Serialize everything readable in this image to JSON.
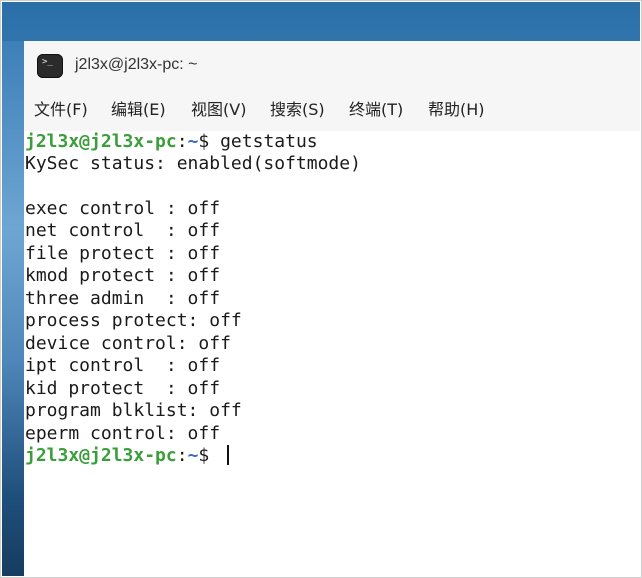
{
  "window": {
    "title": "j2l3x@j2l3x-pc: ~",
    "app_icon": "terminal-icon"
  },
  "menu": {
    "items": [
      {
        "label": "文件(F)"
      },
      {
        "label": "编辑(E)"
      },
      {
        "label": "视图(V)"
      },
      {
        "label": "搜索(S)"
      },
      {
        "label": "终端(T)"
      },
      {
        "label": "帮助(H)"
      }
    ]
  },
  "terminal": {
    "prompt_user": "j2l3x@j2l3x-pc",
    "prompt_sep": ":",
    "prompt_path": "~",
    "prompt_symbol": "$ ",
    "command": "getstatus",
    "status_line": "KySec status: enabled(softmode)",
    "output": [
      "exec control : off",
      "net control  : off",
      "file protect : off",
      "kmod protect : off",
      "three admin  : off",
      "process protect: off",
      "device control: off",
      "ipt control  : off",
      "kid protect  : off",
      "program blklist: off",
      "eperm control: off"
    ]
  },
  "colors": {
    "prompt_user": "#3a9e3a",
    "prompt_path": "#3a6bc8",
    "text": "#1a1a1a",
    "chrome_bg": "#f6f6f6"
  }
}
